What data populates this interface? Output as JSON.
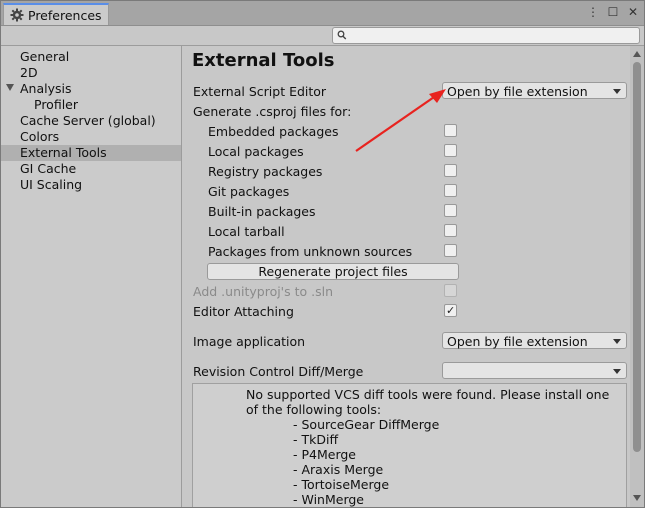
{
  "window": {
    "tab_title": "Preferences",
    "controls": {
      "more": "⋮",
      "maximize": "☐",
      "close": "✕"
    }
  },
  "search": {
    "placeholder": ""
  },
  "sidebar": {
    "items": [
      {
        "label": "General"
      },
      {
        "label": "2D"
      },
      {
        "label": "Analysis"
      },
      {
        "label": "Profiler"
      },
      {
        "label": "Cache Server (global)"
      },
      {
        "label": "Colors"
      },
      {
        "label": "External Tools"
      },
      {
        "label": "GI Cache"
      },
      {
        "label": "UI Scaling"
      }
    ]
  },
  "content": {
    "title": "External Tools",
    "script_editor": {
      "label": "External Script Editor",
      "value": "Open by file extension"
    },
    "generate_label": "Generate .csproj files for:",
    "packages": [
      {
        "label": "Embedded packages",
        "checked": false
      },
      {
        "label": "Local packages",
        "checked": false
      },
      {
        "label": "Registry packages",
        "checked": false
      },
      {
        "label": "Git packages",
        "checked": false
      },
      {
        "label": "Built-in packages",
        "checked": false
      },
      {
        "label": "Local tarball",
        "checked": false
      },
      {
        "label": "Packages from unknown sources",
        "checked": false
      }
    ],
    "regenerate_label": "Regenerate project files",
    "unityproj": {
      "label": "Add .unityproj's to .sln",
      "checked": false
    },
    "editor_attaching": {
      "label": "Editor Attaching",
      "checked": true,
      "tick": "✓"
    },
    "image_app": {
      "label": "Image application",
      "value": "Open by file extension"
    },
    "revision": {
      "label": "Revision Control Diff/Merge",
      "value": ""
    },
    "info": {
      "message": "No supported VCS diff tools were found. Please install one of the following tools:",
      "tools": [
        "- SourceGear DiffMerge",
        "- TkDiff",
        "- P4Merge",
        "- Araxis Merge",
        "- TortoiseMerge",
        "- WinMerge"
      ]
    }
  },
  "colors": {
    "accent_tab": "#5a8ee8",
    "annotation_arrow": "#e8231f",
    "selected_row": "#b0b0b0"
  }
}
